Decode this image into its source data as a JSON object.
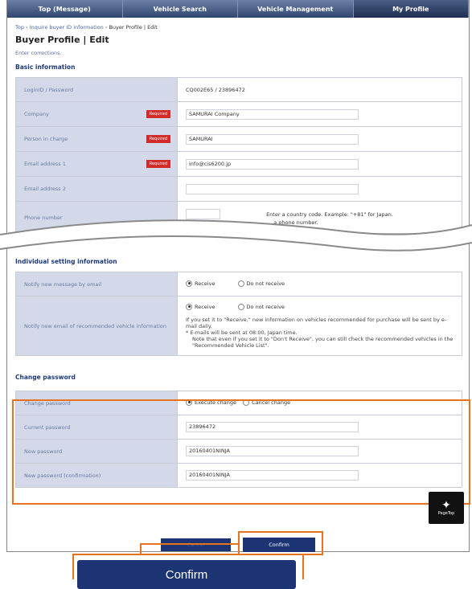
{
  "nav": {
    "items": [
      "Top (Message)",
      "Vehicle Search",
      "Vehicle Management",
      "My Profile"
    ]
  },
  "breadcrumb": {
    "top": "Top",
    "sep1": " › ",
    "inquire": "Inquire buyer ID information",
    "sep2": " › ",
    "current": "Buyer Profile | Edit"
  },
  "page": {
    "title": "Buyer Profile | Edit",
    "instruction": "Enter corrections."
  },
  "basic": {
    "title": "Basic information",
    "required_label": "Required",
    "rows": [
      {
        "label": "LoginID / Password",
        "value": "CQ002E65 / 23896472"
      },
      {
        "label": "Company",
        "value": "SAMURAI Company"
      },
      {
        "label": "Person in charge",
        "value": "SAMURAI"
      },
      {
        "label": "Email address 1",
        "value": "info@cis6200.jp"
      },
      {
        "label": "Email address 2",
        "value": ""
      },
      {
        "label": "Phone number",
        "value": ""
      }
    ],
    "phone_hint1": "Enter a country code. Example: \"+81\" for Japan.",
    "phone_hint2": "...a phone number."
  },
  "individual": {
    "title": "Individual setting information",
    "row1_label": "Notify new message by email",
    "row2_label": "Notify new email of recommended vehicle information",
    "opt_receive": "Receive",
    "opt_not": "Do not receive",
    "note1": "If you set it to \"Receive,\" new information on vehicles recommended for purchase will be sent by e-mail daily.",
    "note2": "* E-mails will be sent at 08:00, Japan time.",
    "note3": "Note that even if you set it to \"Don't Receive\", you can still check the recommended vehicles in the \"Recommended Vehicle List\"."
  },
  "password": {
    "title": "Change password",
    "rows": [
      {
        "label": "Change password"
      },
      {
        "label": "Current password",
        "value": "23896472"
      },
      {
        "label": "New password",
        "value": "20160401NINJA"
      },
      {
        "label": "New password (confirmation)",
        "value": "20160401NINJA"
      }
    ],
    "opt_execute": "Execute change",
    "opt_cancel": "Cancel change"
  },
  "buttons": {
    "cancel": "Cancel",
    "confirm": "Confirm",
    "confirm_zoom": "Confirm"
  },
  "pagetop": {
    "label": "PageTop"
  },
  "colors": {
    "accent": "#e8731d",
    "navy": "#1c3473",
    "label_bg": "#d3d9e8",
    "required": "#d32a2a"
  }
}
